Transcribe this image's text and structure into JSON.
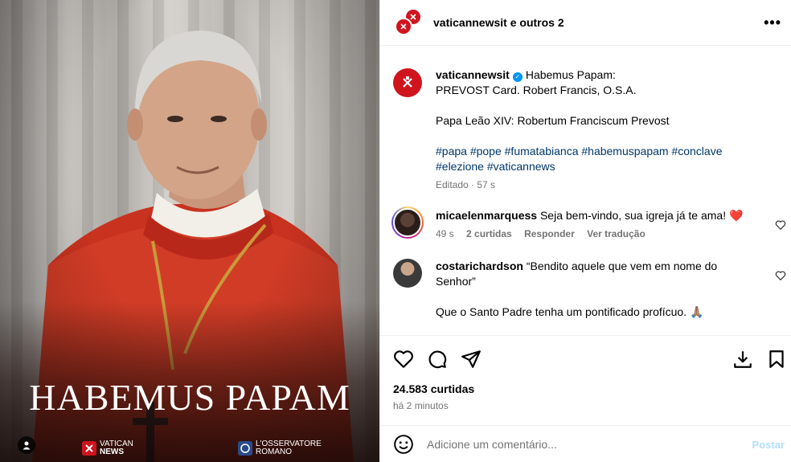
{
  "media": {
    "headline": "HABEMUS PAPAM",
    "logo_left": {
      "line1": "Vatican",
      "line2": "News"
    },
    "logo_right": {
      "line1": "L'Osservatore",
      "line2": "Romano"
    }
  },
  "header": {
    "account": "vaticannewsit",
    "collab_text": " e outros 2",
    "more_icon": "more-horizontal-icon"
  },
  "caption": {
    "username": "vaticannewsit",
    "line1": "Habemus Papam:",
    "line2": "PREVOST Card. Robert Francis, O.S.A.",
    "line3": "Papa Leão XIV: Robertum Franciscum Prevost",
    "hashtags_1": "#papa #pope #fumatabianca #habemuspapam #conclave",
    "hashtags_2": "#elezione #vaticannews",
    "meta": "Editado · 57 s"
  },
  "comments": [
    {
      "username": "micaelenmarquess",
      "text": "Seja bem-vindo, sua igreja já te ama! ❤️",
      "time": "49 s",
      "likes": "2 curtidas",
      "reply": "Responder",
      "translate": "Ver tradução"
    },
    {
      "username": "costarichardson",
      "text_a": "“Bendito aquele que vem em nome do",
      "text_b": "Senhor”",
      "text_c": "Que o Santo Padre tenha um pontificado profícuo. 🙏🏽"
    }
  ],
  "stats": {
    "likes": "24.583 curtidas",
    "time": "há 2 minutos"
  },
  "composer": {
    "placeholder": "Adicione um comentário...",
    "post_label": "Postar"
  },
  "colors": {
    "brand_red": "#d0141d",
    "link": "#00376b",
    "muted": "#737373",
    "heart": "#ff3040"
  }
}
